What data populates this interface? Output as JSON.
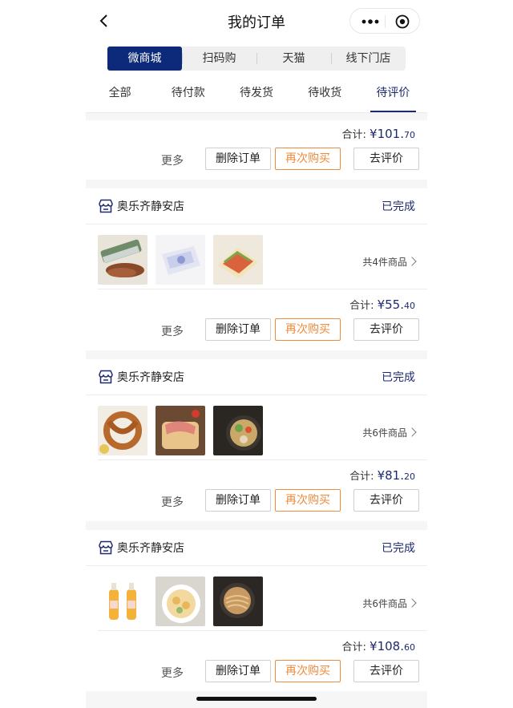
{
  "header": {
    "title": "我的订单",
    "icons": {
      "back": "chevron-left-icon",
      "more": "more-dots-icon",
      "target": "target-icon"
    }
  },
  "channels": {
    "items": [
      "微商城",
      "扫码购",
      "天猫",
      "线下门店"
    ],
    "active_index": 0,
    "active_color": "#0d2a7a"
  },
  "tabs": {
    "items": [
      "全部",
      "待付款",
      "待发货",
      "待收货",
      "待评价"
    ],
    "active_index": 4,
    "accent_color": "#1e2a6e"
  },
  "orders": [
    {
      "total_label": "合计:",
      "currency": "¥",
      "total_int": "101.",
      "total_dec": "70",
      "more_label": "更多",
      "delete_label": "删除订单",
      "rebuy_label": "再次购买",
      "review_label": "去评价"
    },
    {
      "store_name": "奥乐齐静安店",
      "status": "已完成",
      "item_count": "共4件商品",
      "thumbnails": [
        "sausage-with-wrap-photo",
        "wet-wipes-pack-photo",
        "sandwich-photo"
      ],
      "total_label": "合计:",
      "currency": "¥",
      "total_int": "55.",
      "total_dec": "40",
      "more_label": "更多",
      "delete_label": "删除订单",
      "rebuy_label": "再次购买",
      "review_label": "去评价"
    },
    {
      "store_name": "奥乐齐静安店",
      "status": "已完成",
      "item_count": "共6件商品",
      "thumbnails": [
        "pretzel-photo",
        "ham-toast-photo",
        "grain-bowl-photo"
      ],
      "total_label": "合计:",
      "currency": "¥",
      "total_int": "81.",
      "total_dec": "20",
      "more_label": "更多",
      "delete_label": "删除订单",
      "rebuy_label": "再次购买",
      "review_label": "去评价"
    },
    {
      "store_name": "奥乐齐静安店",
      "status": "已完成",
      "item_count": "共6件商品",
      "thumbnails": [
        "juice-bottles-photo",
        "potato-salad-photo",
        "noodle-bowl-photo"
      ],
      "total_label": "合计:",
      "currency": "¥",
      "total_int": "108.",
      "total_dec": "60",
      "more_label": "更多",
      "delete_label": "删除订单",
      "rebuy_label": "再次购买",
      "review_label": "去评价"
    }
  ],
  "colors": {
    "rebuy_border": "#f08a3a",
    "status": "#1e2a6e"
  }
}
